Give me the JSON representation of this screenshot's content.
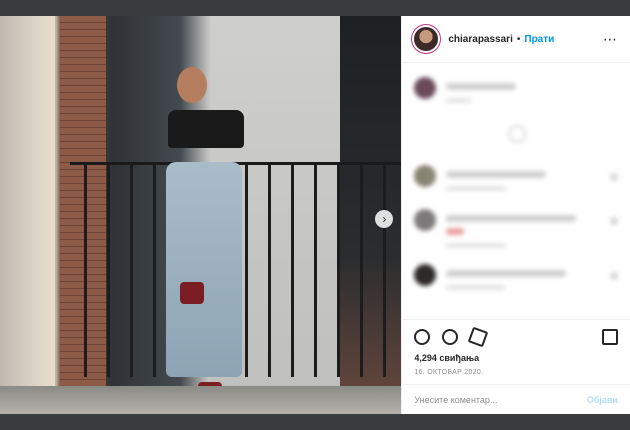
{
  "post": {
    "username": "chiarapassari",
    "separator": "•",
    "follow_label": "Прати",
    "more_icon": "⋯",
    "likes_text": "4,294 свиђања",
    "date_text": "16. ОКТОБАР 2020.",
    "next_icon": "›"
  },
  "comment": {
    "placeholder": "Унесите коментар...",
    "post_label": "Објави"
  },
  "colors": {
    "accent": "#0095f6",
    "post_disabled": "#b2dffc",
    "story_ring": "#c13584"
  }
}
